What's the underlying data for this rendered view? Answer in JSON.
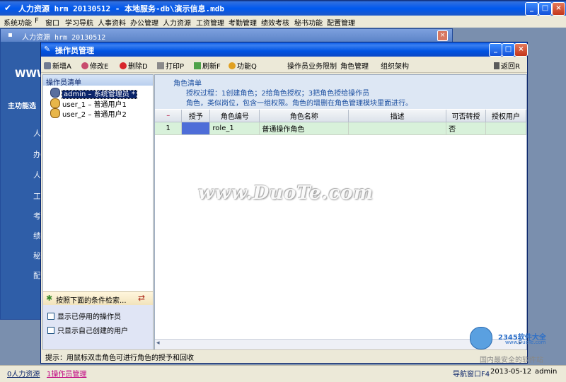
{
  "app": {
    "title": "人力资源 hrm 20130512 - 本地服务-db\\演示信息.mdb",
    "controls": [
      "_",
      "□",
      "×"
    ]
  },
  "menu": [
    "系统功能",
    "F",
    "窗口",
    "学习导航",
    "人事资料",
    "办公管理",
    "人力资源",
    "工资管理",
    "考勤管理",
    "绩效考核",
    "秘书功能",
    "配置管理"
  ],
  "bg_window": {
    "title": "人力资源 hrm 20130512",
    "www": "WWW",
    "func": "主功能选",
    "side_chars": [
      "人",
      "办",
      "人",
      "工",
      "考",
      "绩",
      "秘",
      "配"
    ]
  },
  "op_window": {
    "title": "操作员管理",
    "toolbar": {
      "add": "新增A",
      "edit": "修改E",
      "delete": "删除D",
      "print": "打印P",
      "refresh": "刷新F",
      "func": "功能Q",
      "biz_limit": "操作员业务限制",
      "role_mgmt": "角色管理",
      "org": "组织架构",
      "back": "返回R"
    },
    "left": {
      "header": "操作员清单",
      "users": [
        "admin – 系统管理员 *",
        "user_1 – 普通用户1",
        "user_2 – 普通用户2"
      ],
      "search": "按照下面的条件检索...",
      "opt1": "显示已停用的操作员",
      "opt2": "只显示自己创建的用户"
    },
    "right": {
      "title": "角色清单",
      "line1": "授权过程：1创建角色；2给角色授权；3把角色授给操作员",
      "line2": "角色，类似岗位，包含一组权限。角色的增删在角色管理模块里面进行。",
      "columns": [
        "–",
        "授予",
        "角色编号",
        "角色名称",
        "描述",
        "可否转授",
        "授权用户"
      ],
      "rows": [
        [
          "1",
          "",
          "role_1",
          "普通操作角色",
          "",
          "否",
          ""
        ]
      ]
    },
    "hint": "提示：用鼠标双击角色可进行角色的授予和回收"
  },
  "watermark": "www.DuoTe.com",
  "logo": {
    "brand": "2345软件大全",
    "url": "www.DuoTe.com",
    "caption": "国内最安全的软件站"
  },
  "taskbar": {
    "item0": "0人力资源",
    "item1": "1操作员管理",
    "nav": "导航窗口F4",
    "date": "2013-05-12",
    "user": "admin"
  }
}
